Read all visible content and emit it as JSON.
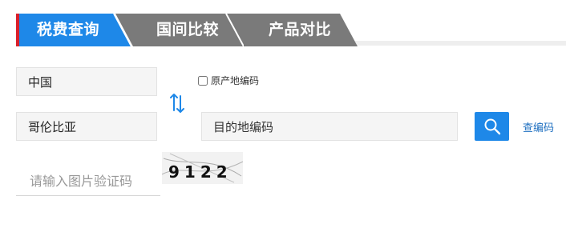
{
  "tabs": [
    {
      "label": "税费查询",
      "active": true
    },
    {
      "label": "国间比较",
      "active": false
    },
    {
      "label": "产品对比",
      "active": false
    }
  ],
  "form": {
    "origin_value": "中国",
    "destination_value": "哥伦比亚",
    "origin_code_checkbox_label": "原产地编码",
    "hs_code_placeholder": "目的地编码",
    "lookup_link": "查编码",
    "captcha_placeholder": "请输入图片验证码",
    "captcha_text": "9122"
  },
  "colors": {
    "accent": "#1e88e8",
    "inactive_tab": "#7a7a7a",
    "marker_red": "#d9202b",
    "field_bg": "#f5f5f5"
  },
  "icons": {
    "swap": "swap-arrows-icon",
    "search": "search-icon"
  }
}
